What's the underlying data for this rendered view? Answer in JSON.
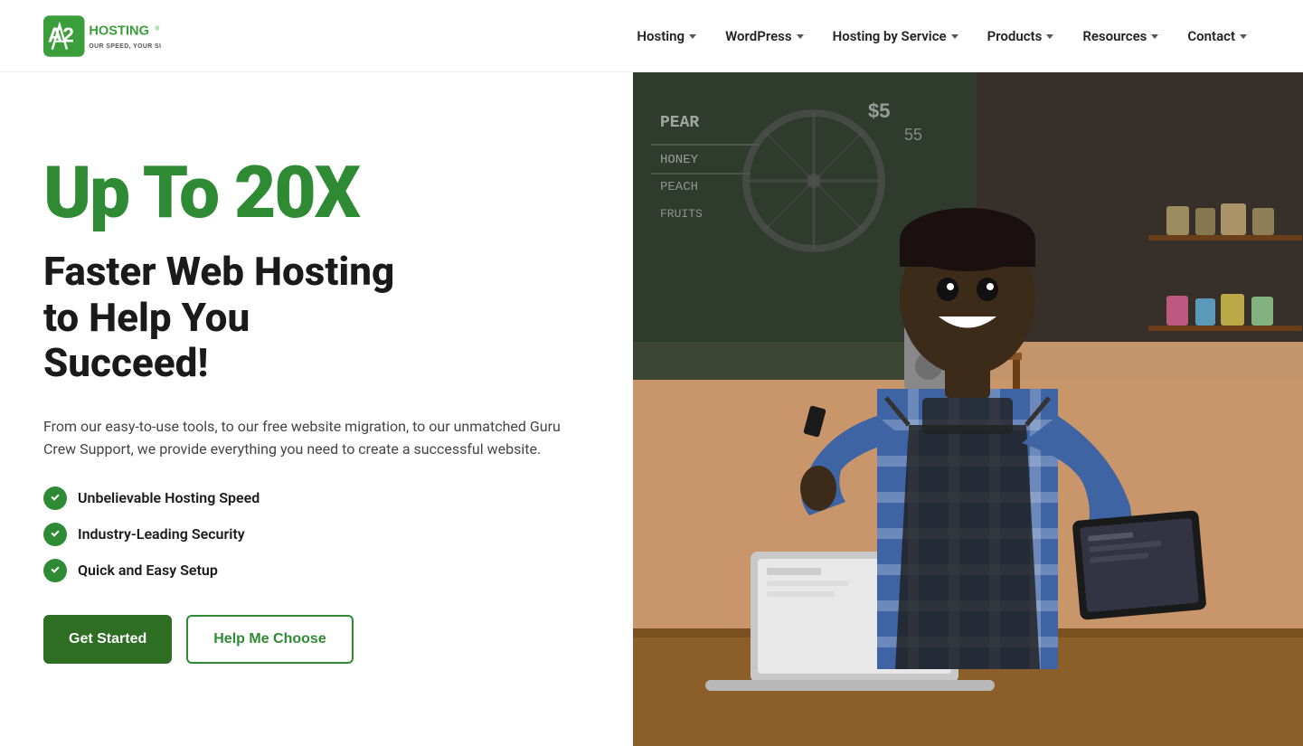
{
  "brand": {
    "logo_text": "A2 HOSTING",
    "logo_tagline": "OUR SPEED, YOUR SUCCESS",
    "logo_number": "2",
    "logo_letter": "A"
  },
  "nav": {
    "items": [
      {
        "label": "Hosting",
        "has_dropdown": true
      },
      {
        "label": "WordPress",
        "has_dropdown": true
      },
      {
        "label": "Hosting by Service",
        "has_dropdown": true
      },
      {
        "label": "Products",
        "has_dropdown": true
      },
      {
        "label": "Resources",
        "has_dropdown": true
      },
      {
        "label": "Contact",
        "has_dropdown": true
      }
    ]
  },
  "hero": {
    "tagline": "Up To 20X",
    "subtitle_line1": "Faster Web Hosting",
    "subtitle_line2": "to Help You",
    "subtitle_line3": "Succeed!",
    "description": "From our easy-to-use tools, to our free website migration, to our unmatched Guru Crew Support, we provide everything you need to create a successful website.",
    "features": [
      {
        "label": "Unbelievable Hosting Speed"
      },
      {
        "label": "Industry-Leading Security"
      },
      {
        "label": "Quick and Easy Setup"
      }
    ],
    "cta_primary": "Get Started",
    "cta_secondary": "Help Me Choose"
  },
  "colors": {
    "green_primary": "#2e8b34",
    "green_dark": "#2e6e22",
    "text_dark": "#1a1a1a",
    "text_muted": "#444"
  }
}
